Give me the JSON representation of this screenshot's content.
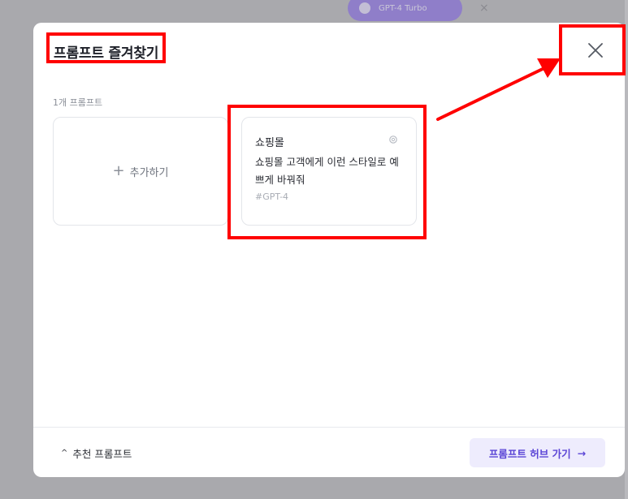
{
  "background": {
    "pill_label": "GPT-4 Turbo",
    "close_glyph": "×"
  },
  "modal": {
    "title": "프롬프트 즐겨찾기",
    "count_label": "1개 프롬프트",
    "add_card": {
      "plus": "+",
      "label": "추가하기"
    },
    "prompt": {
      "name": "쇼핑몰",
      "description": "쇼핑몰 고객에게 이런 스타일로 예쁘게 바꿔줘",
      "tag": "#GPT-4"
    },
    "footer": {
      "recommended_label": "추천 프롬프트",
      "chevron": "^",
      "hub_button_label": "프롬프트 허브 가기",
      "hub_arrow": "→"
    }
  },
  "colors": {
    "accent": "#5b45d6",
    "accent_bg": "#eeecfd",
    "highlight": "#ff0000",
    "overlay": "#a9a9ad"
  },
  "icons": {
    "close": "close-icon",
    "settings": "gear-icon",
    "plus": "plus-icon",
    "chevron": "chevron-up-icon",
    "arrow": "arrow-right-icon"
  }
}
